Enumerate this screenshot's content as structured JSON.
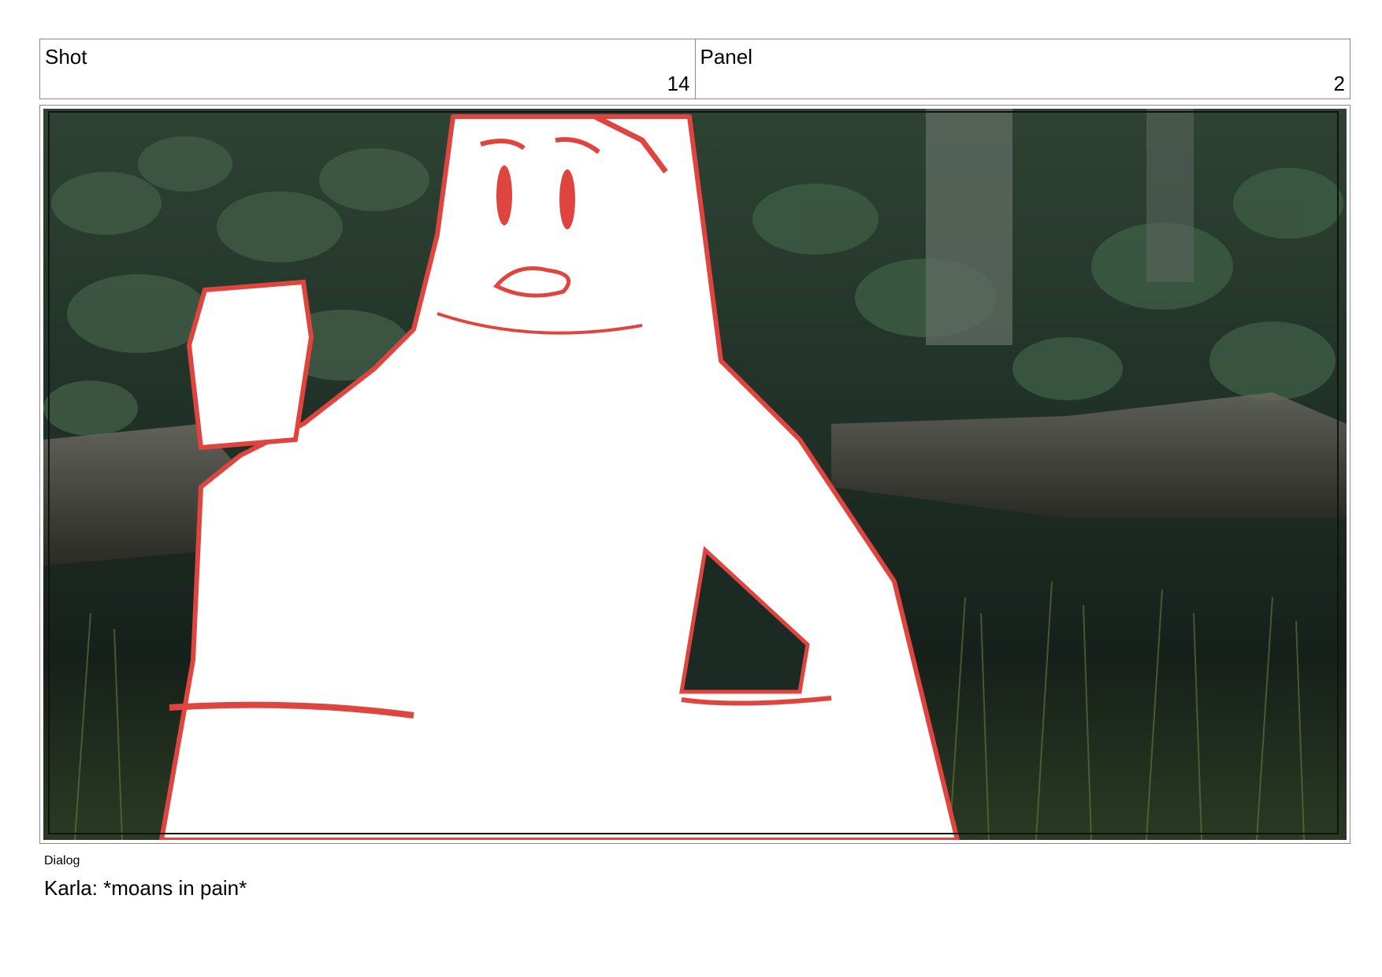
{
  "header": {
    "shot_label": "Shot",
    "shot_value": "14",
    "panel_label": "Panel",
    "panel_value": "2"
  },
  "panel": {
    "image_subject": "storyboard-sketch-figure-in-forest"
  },
  "dialog": {
    "label": "Dialog",
    "text": "Karla: *moans in pain*"
  },
  "colors": {
    "sketch_red": "#e0443f",
    "foliage_dark": "#1b2a22",
    "border": "#8a8a8a"
  }
}
